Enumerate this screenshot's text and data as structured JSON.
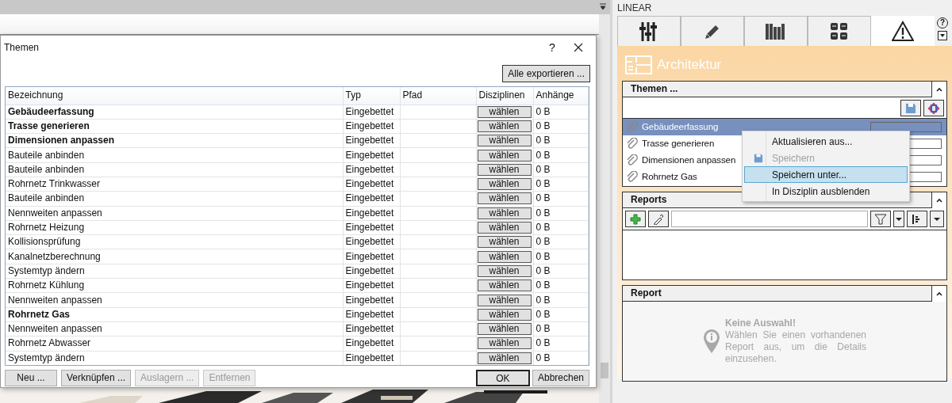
{
  "dialog": {
    "title": "Themen",
    "help": "?",
    "export_button": "Alle exportieren ...",
    "table": {
      "columns": [
        "Bezeichnung",
        "Typ",
        "Pfad",
        "Disziplinen",
        "Anhänge"
      ],
      "rows": [
        {
          "name": "Gebäudeerfassung",
          "bold": true,
          "type": "Eingebettet",
          "disciplines": "wählen",
          "attachments": "0 B"
        },
        {
          "name": "Trasse generieren",
          "bold": true,
          "type": "Eingebettet",
          "disciplines": "wählen",
          "attachments": "0 B"
        },
        {
          "name": "Dimensionen anpassen",
          "bold": true,
          "type": "Eingebettet",
          "disciplines": "wählen",
          "attachments": "0 B"
        },
        {
          "name": "Bauteile anbinden",
          "bold": false,
          "type": "Eingebettet",
          "disciplines": "wählen",
          "attachments": "0 B"
        },
        {
          "name": "Bauteile anbinden",
          "bold": false,
          "type": "Eingebettet",
          "disciplines": "wählen",
          "attachments": "0 B"
        },
        {
          "name": "Rohrnetz Trinkwasser",
          "bold": false,
          "type": "Eingebettet",
          "disciplines": "wählen",
          "attachments": "0 B"
        },
        {
          "name": "Bauteile anbinden",
          "bold": false,
          "type": "Eingebettet",
          "disciplines": "wählen",
          "attachments": "0 B"
        },
        {
          "name": "Nennweiten anpassen",
          "bold": false,
          "type": "Eingebettet",
          "disciplines": "wählen",
          "attachments": "0 B"
        },
        {
          "name": "Rohrnetz Heizung",
          "bold": false,
          "type": "Eingebettet",
          "disciplines": "wählen",
          "attachments": "0 B"
        },
        {
          "name": "Kollisionsprüfung",
          "bold": false,
          "type": "Eingebettet",
          "disciplines": "wählen",
          "attachments": "0 B"
        },
        {
          "name": "Kanalnetzberechnung",
          "bold": false,
          "type": "Eingebettet",
          "disciplines": "wählen",
          "attachments": "0 B"
        },
        {
          "name": "Systemtyp ändern",
          "bold": false,
          "type": "Eingebettet",
          "disciplines": "wählen",
          "attachments": "0 B"
        },
        {
          "name": "Rohrnetz Kühlung",
          "bold": false,
          "type": "Eingebettet",
          "disciplines": "wählen",
          "attachments": "0 B"
        },
        {
          "name": "Nennweiten anpassen",
          "bold": false,
          "type": "Eingebettet",
          "disciplines": "wählen",
          "attachments": "0 B"
        },
        {
          "name": "Rohrnetz Gas",
          "bold": true,
          "type": "Eingebettet",
          "disciplines": "wählen",
          "attachments": "0 B"
        },
        {
          "name": "Nennweiten anpassen",
          "bold": false,
          "type": "Eingebettet",
          "disciplines": "wählen",
          "attachments": "0 B"
        },
        {
          "name": "Rohrnetz Abwasser",
          "bold": false,
          "type": "Eingebettet",
          "disciplines": "wählen",
          "attachments": "0 B"
        },
        {
          "name": "Systemtyp ändern",
          "bold": false,
          "type": "Eingebettet",
          "disciplines": "wählen",
          "attachments": "0 B"
        }
      ]
    },
    "left_buttons": [
      {
        "label": "Neu ...",
        "disabled": false
      },
      {
        "label": "Verknüpfen ...",
        "disabled": false
      },
      {
        "label": "Auslagern ...",
        "disabled": true
      },
      {
        "label": "Entfernen",
        "disabled": true
      }
    ],
    "right_buttons": [
      {
        "label": "OK",
        "default": true
      },
      {
        "label": "Abbrechen",
        "default": false
      }
    ]
  },
  "panel": {
    "title": "LINEAR",
    "help": "?",
    "tabs": [
      {
        "kind": "mixer",
        "selected": false
      },
      {
        "kind": "pencil",
        "selected": false
      },
      {
        "kind": "books",
        "selected": false
      },
      {
        "kind": "grid",
        "selected": false
      },
      {
        "kind": "warning",
        "selected": true
      }
    ],
    "discipline": "Architektur",
    "themes": {
      "title": "Themen ...",
      "expanded": true,
      "items": [
        {
          "label": "Gebäudeerfassung",
          "selected": true
        },
        {
          "label": "Trasse generieren",
          "selected": false
        },
        {
          "label": "Dimensionen anpassen",
          "selected": false
        },
        {
          "label": "Rohrnetz Gas",
          "selected": false
        }
      ]
    },
    "context_menu": [
      {
        "label": "Aktualisieren aus...",
        "disabled": false,
        "selected": false,
        "icon": false
      },
      {
        "label": "Speichern",
        "disabled": true,
        "selected": false,
        "icon": true
      },
      {
        "label": "Speichern unter...",
        "disabled": false,
        "selected": true,
        "icon": false
      },
      {
        "label": "In Disziplin ausblenden",
        "disabled": false,
        "selected": false,
        "icon": false
      }
    ],
    "reports": {
      "title": "Reports",
      "expanded": true
    },
    "report": {
      "title": "Report",
      "expanded": true,
      "message_title": "Keine Auswahl!",
      "message": "Wählen Sie einen vorhandenen Report aus, um die Details einzusehen."
    }
  }
}
